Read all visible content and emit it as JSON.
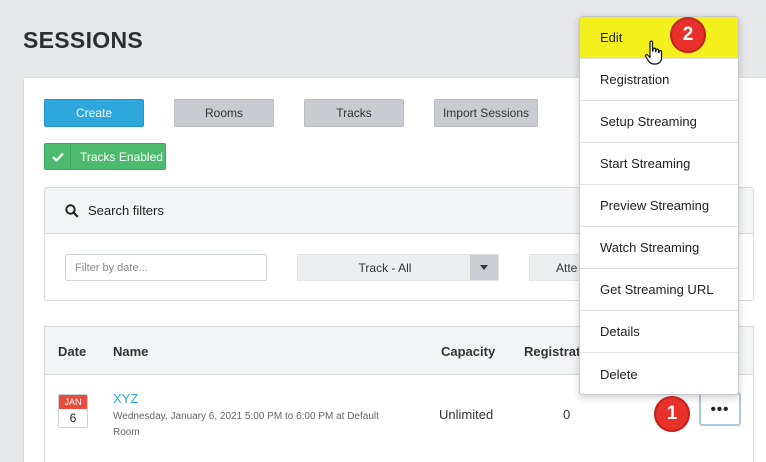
{
  "page": {
    "title": "SESSIONS"
  },
  "toolbar": {
    "create_label": "Create",
    "rooms_label": "Rooms",
    "tracks_label": "Tracks",
    "import_label": "Import Sessions",
    "tracks_enabled_label": "Tracks Enabled"
  },
  "filters": {
    "header": "Search filters",
    "date_placeholder": "Filter by date...",
    "track_value": "Track - All",
    "attendance_value": "Atte"
  },
  "table": {
    "columns": {
      "date": "Date",
      "name": "Name",
      "capacity": "Capacity",
      "registrations": "Registrati"
    },
    "rows": [
      {
        "month": "JAN",
        "day": "6",
        "name": "XYZ",
        "when_line1": "Wednesday, January 6, 2021 5:00 PM to 6:00 PM at Default",
        "when_line2": "Room",
        "capacity": "Unlimited",
        "registrations": "0",
        "more_label": "•••"
      }
    ]
  },
  "menu": {
    "items": [
      "Edit",
      "Registration",
      "Setup Streaming",
      "Start Streaming",
      "Preview Streaming",
      "Watch Streaming",
      "Get Streaming URL",
      "Details",
      "Delete"
    ]
  },
  "annotations": {
    "step1": "1",
    "step2": "2"
  },
  "colors": {
    "primary": "#2ea7dc",
    "success": "#4dbb6e",
    "highlight": "#f4f01e",
    "badge": "#e8312b"
  }
}
